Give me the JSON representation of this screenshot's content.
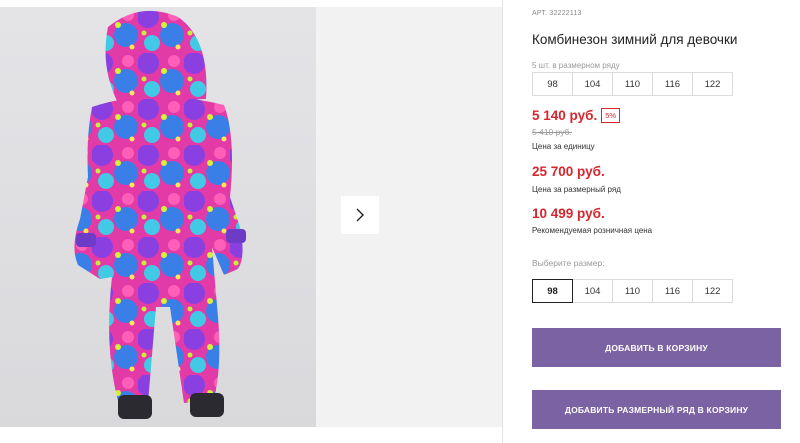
{
  "product": {
    "article": "АРТ. 32222113",
    "title": "Комбинезон зимний для девочки",
    "size_row_caption": "5 шт. в размерном ряду",
    "size_row": [
      "98",
      "104",
      "110",
      "116",
      "122"
    ],
    "price": "5 140 руб.",
    "discount": "5%",
    "old_price": "5 410 руб.",
    "price_caption": "Цена за единицу",
    "row_price": "25 700 руб.",
    "row_price_caption": "Цена за размерный ряд",
    "rrp": "10 499 руб.",
    "rrp_caption": "Рекомендуемая розничная цена",
    "choose_size_label": "Выберите размер:",
    "sizes": [
      "98",
      "104",
      "110",
      "116",
      "122"
    ],
    "selected_size": "98"
  },
  "gallery": {
    "next_icon": "chevron-right-icon"
  },
  "actions": {
    "add_to_cart": "Добавить в корзину",
    "add_row_to_cart": "Добавить размерный ряд в корзину"
  },
  "colors": {
    "price_red": "#d6262e",
    "button_purple": "#7b62a3"
  }
}
